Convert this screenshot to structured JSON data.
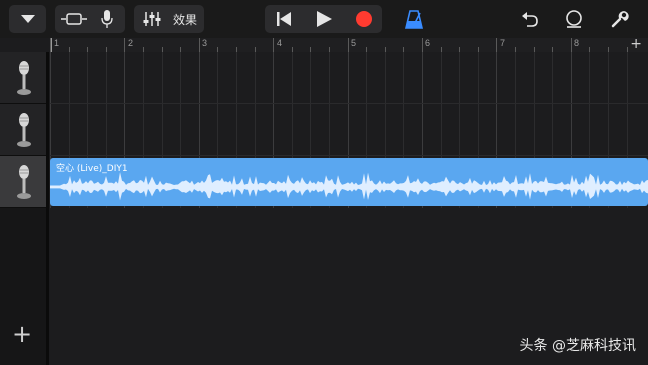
{
  "toolbar": {
    "effects_label": "效果"
  },
  "ruler": {
    "bars": [
      "1",
      "2",
      "3",
      "4",
      "5",
      "6",
      "7",
      "8"
    ],
    "add_section": "+"
  },
  "tracks": [
    {
      "icon": "microphone-icon",
      "selected": false
    },
    {
      "icon": "microphone-icon",
      "selected": false
    },
    {
      "icon": "microphone-icon",
      "selected": true
    }
  ],
  "add_track": "+",
  "region": {
    "name": "空心 (Live)_DIY1",
    "color": "#5aa7f0",
    "waveform_color": "#dfeeff"
  },
  "colors": {
    "record": "#ff3b30",
    "metronome": "#3a8cff",
    "background": "#1c1c1e"
  },
  "watermark": "头条 @芝麻科技讯"
}
